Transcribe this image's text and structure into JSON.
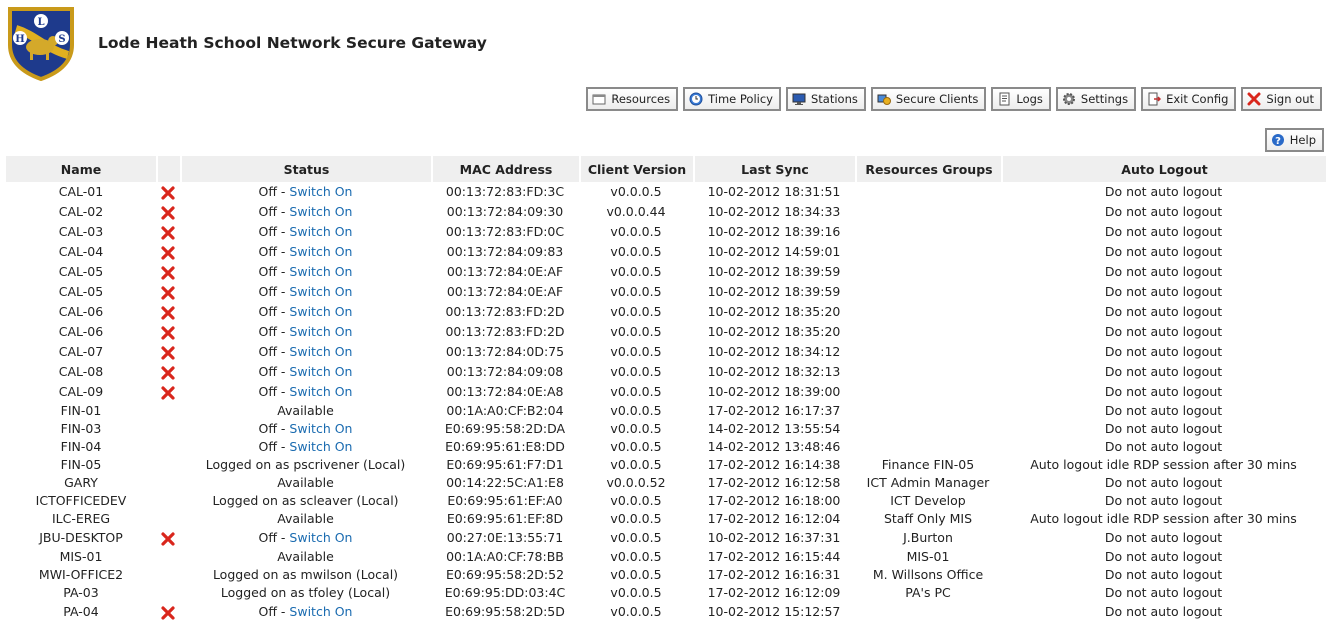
{
  "header": {
    "logo_letters": [
      "L",
      "H",
      "S"
    ],
    "title": "Lode Heath School Network Secure Gateway"
  },
  "toolbar": [
    {
      "icon": "resources-icon",
      "label": "Resources"
    },
    {
      "icon": "clock-icon",
      "label": "Time Policy"
    },
    {
      "icon": "monitor-icon",
      "label": "Stations"
    },
    {
      "icon": "secure-clients-icon",
      "label": "Secure Clients"
    },
    {
      "icon": "logs-icon",
      "label": "Logs"
    },
    {
      "icon": "gear-icon",
      "label": "Settings"
    },
    {
      "icon": "exit-config-icon",
      "label": "Exit Config"
    },
    {
      "icon": "close-icon",
      "label": "Sign out"
    }
  ],
  "help_label": "Help",
  "colors": {
    "link": "#1a6bb0",
    "header_bg": "#efefef",
    "error_icon": "#d9261c"
  },
  "table": {
    "columns": [
      "Name",
      "",
      "Status",
      "MAC Address",
      "Client Version",
      "Last Sync",
      "Resources Groups",
      "Auto Logout"
    ],
    "rows": [
      {
        "name": "CAL-01",
        "x": true,
        "status": "Off - ",
        "link": "Switch On",
        "mac": "00:13:72:83:FD:3C",
        "ver": "v0.0.0.5",
        "sync": "10-02-2012 18:31:51",
        "group": "",
        "logout": "Do not auto logout"
      },
      {
        "name": "CAL-02",
        "x": true,
        "status": "Off - ",
        "link": "Switch On",
        "mac": "00:13:72:84:09:30",
        "ver": "v0.0.0.44",
        "sync": "10-02-2012 18:34:33",
        "group": "",
        "logout": "Do not auto logout"
      },
      {
        "name": "CAL-03",
        "x": true,
        "status": "Off - ",
        "link": "Switch On",
        "mac": "00:13:72:83:FD:0C",
        "ver": "v0.0.0.5",
        "sync": "10-02-2012 18:39:16",
        "group": "",
        "logout": "Do not auto logout"
      },
      {
        "name": "CAL-04",
        "x": true,
        "status": "Off - ",
        "link": "Switch On",
        "mac": "00:13:72:84:09:83",
        "ver": "v0.0.0.5",
        "sync": "10-02-2012 14:59:01",
        "group": "",
        "logout": "Do not auto logout"
      },
      {
        "name": "CAL-05",
        "x": true,
        "status": "Off - ",
        "link": "Switch On",
        "mac": "00:13:72:84:0E:AF",
        "ver": "v0.0.0.5",
        "sync": "10-02-2012 18:39:59",
        "group": "",
        "logout": "Do not auto logout"
      },
      {
        "name": "CAL-05",
        "x": true,
        "status": "Off - ",
        "link": "Switch On",
        "mac": "00:13:72:84:0E:AF",
        "ver": "v0.0.0.5",
        "sync": "10-02-2012 18:39:59",
        "group": "",
        "logout": "Do not auto logout"
      },
      {
        "name": "CAL-06",
        "x": true,
        "status": "Off - ",
        "link": "Switch On",
        "mac": "00:13:72:83:FD:2D",
        "ver": "v0.0.0.5",
        "sync": "10-02-2012 18:35:20",
        "group": "",
        "logout": "Do not auto logout"
      },
      {
        "name": "CAL-06",
        "x": true,
        "status": "Off - ",
        "link": "Switch On",
        "mac": "00:13:72:83:FD:2D",
        "ver": "v0.0.0.5",
        "sync": "10-02-2012 18:35:20",
        "group": "",
        "logout": "Do not auto logout"
      },
      {
        "name": "CAL-07",
        "x": true,
        "status": "Off - ",
        "link": "Switch On",
        "mac": "00:13:72:84:0D:75",
        "ver": "v0.0.0.5",
        "sync": "10-02-2012 18:34:12",
        "group": "",
        "logout": "Do not auto logout"
      },
      {
        "name": "CAL-08",
        "x": true,
        "status": "Off - ",
        "link": "Switch On",
        "mac": "00:13:72:84:09:08",
        "ver": "v0.0.0.5",
        "sync": "10-02-2012 18:32:13",
        "group": "",
        "logout": "Do not auto logout"
      },
      {
        "name": "CAL-09",
        "x": true,
        "status": "Off - ",
        "link": "Switch On",
        "mac": "00:13:72:84:0E:A8",
        "ver": "v0.0.0.5",
        "sync": "10-02-2012 18:39:00",
        "group": "",
        "logout": "Do not auto logout"
      },
      {
        "name": "FIN-01",
        "x": false,
        "status": "Available",
        "link": "",
        "mac": "00:1A:A0:CF:B2:04",
        "ver": "v0.0.0.5",
        "sync": "17-02-2012 16:17:37",
        "group": "",
        "logout": "Do not auto logout"
      },
      {
        "name": "FIN-03",
        "x": false,
        "status": "Off - ",
        "link": "Switch On",
        "mac": "E0:69:95:58:2D:DA",
        "ver": "v0.0.0.5",
        "sync": "14-02-2012 13:55:54",
        "group": "",
        "logout": "Do not auto logout"
      },
      {
        "name": "FIN-04",
        "x": false,
        "status": "Off - ",
        "link": "Switch On",
        "mac": "E0:69:95:61:E8:DD",
        "ver": "v0.0.0.5",
        "sync": "14-02-2012 13:48:46",
        "group": "",
        "logout": "Do not auto logout"
      },
      {
        "name": "FIN-05",
        "x": false,
        "status": "Logged on as pscrivener (Local)",
        "link": "",
        "mac": "E0:69:95:61:F7:D1",
        "ver": "v0.0.0.5",
        "sync": "17-02-2012 16:14:38",
        "group": "Finance FIN-05",
        "logout": "Auto logout idle RDP session after 30 mins"
      },
      {
        "name": "GARY",
        "x": false,
        "status": "Available",
        "link": "",
        "mac": "00:14:22:5C:A1:E8",
        "ver": "v0.0.0.52",
        "sync": "17-02-2012 16:12:58",
        "group": "ICT Admin Manager",
        "logout": "Do not auto logout"
      },
      {
        "name": "ICTOFFICEDEV",
        "x": false,
        "status": "Logged on as scleaver (Local)",
        "link": "",
        "mac": "E0:69:95:61:EF:A0",
        "ver": "v0.0.0.5",
        "sync": "17-02-2012 16:18:00",
        "group": "ICT Develop",
        "logout": "Do not auto logout"
      },
      {
        "name": "ILC-EREG",
        "x": false,
        "status": "Available",
        "link": "",
        "mac": "E0:69:95:61:EF:8D",
        "ver": "v0.0.0.5",
        "sync": "17-02-2012 16:12:04",
        "group": "Staff Only MIS",
        "logout": "Auto logout idle RDP session after 30 mins"
      },
      {
        "name": "JBU-DESKTOP",
        "x": true,
        "status": "Off - ",
        "link": "Switch On",
        "mac": "00:27:0E:13:55:71",
        "ver": "v0.0.0.5",
        "sync": "10-02-2012 16:37:31",
        "group": "J.Burton",
        "logout": "Do not auto logout"
      },
      {
        "name": "MIS-01",
        "x": false,
        "status": "Available",
        "link": "",
        "mac": "00:1A:A0:CF:78:BB",
        "ver": "v0.0.0.5",
        "sync": "17-02-2012 16:15:44",
        "group": "MIS-01",
        "logout": "Do not auto logout"
      },
      {
        "name": "MWI-OFFICE2",
        "x": false,
        "status": "Logged on as mwilson (Local)",
        "link": "",
        "mac": "E0:69:95:58:2D:52",
        "ver": "v0.0.0.5",
        "sync": "17-02-2012 16:16:31",
        "group": "M. Willsons Office",
        "logout": "Do not auto logout"
      },
      {
        "name": "PA-03",
        "x": false,
        "status": "Logged on as tfoley (Local)",
        "link": "",
        "mac": "E0:69:95:DD:03:4C",
        "ver": "v0.0.0.5",
        "sync": "17-02-2012 16:12:09",
        "group": "PA's PC",
        "logout": "Do not auto logout"
      },
      {
        "name": "PA-04",
        "x": true,
        "status": "Off - ",
        "link": "Switch On",
        "mac": "E0:69:95:58:2D:5D",
        "ver": "v0.0.0.5",
        "sync": "10-02-2012 15:12:57",
        "group": "",
        "logout": "Do not auto logout"
      }
    ]
  }
}
